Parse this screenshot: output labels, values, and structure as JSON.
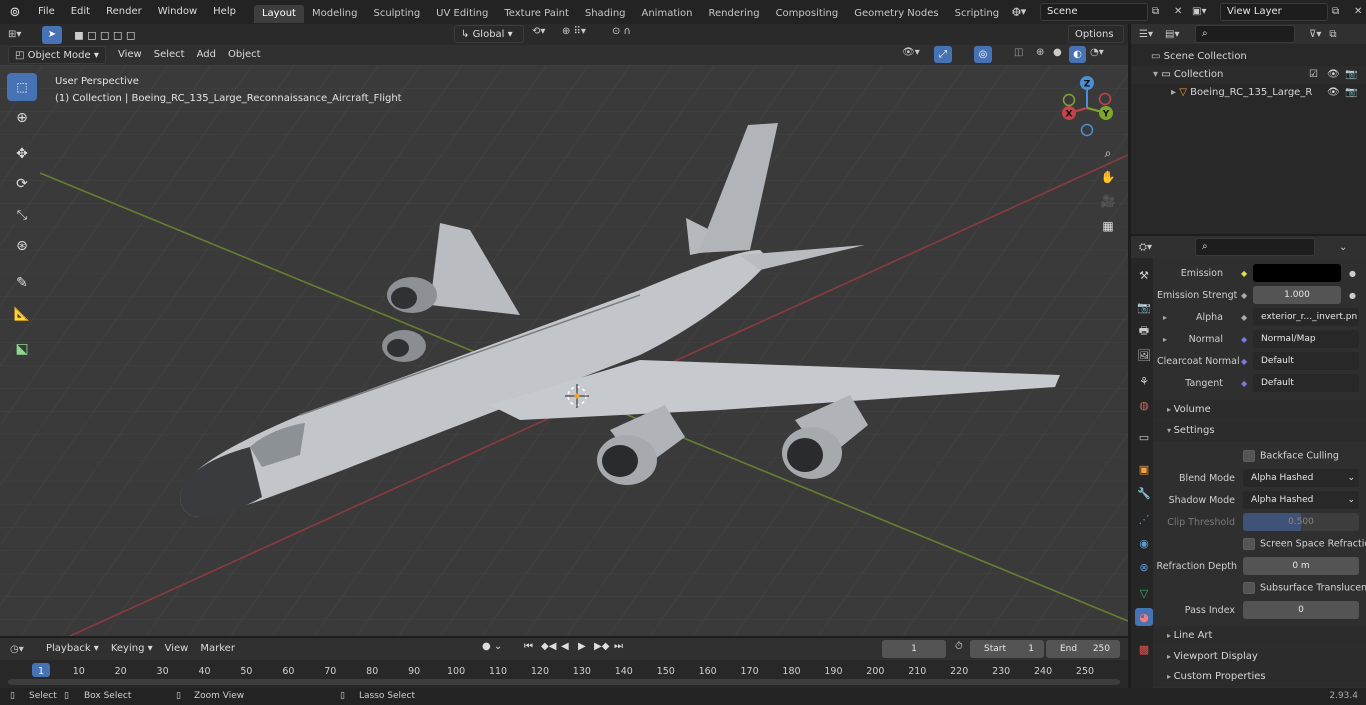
{
  "topbar": {
    "menus": [
      "File",
      "Edit",
      "Render",
      "Window",
      "Help"
    ],
    "workspaces": [
      "Layout",
      "Modeling",
      "Sculpting",
      "UV Editing",
      "Texture Paint",
      "Shading",
      "Animation",
      "Rendering",
      "Compositing",
      "Geometry Nodes",
      "Scripting"
    ],
    "active_workspace": "Layout",
    "scene": "Scene",
    "view_layer": "View Layer"
  },
  "viewport_header": {
    "mode": "Object Mode",
    "menus": [
      "View",
      "Select",
      "Add",
      "Object"
    ],
    "orientation": "Global",
    "options": "Options"
  },
  "viewport": {
    "perspective": "User Perspective",
    "collection_info": "(1) Collection | Boeing_RC_135_Large_Reconnaissance_Aircraft_Flight",
    "gizmo": {
      "z": "Z",
      "y": "Y",
      "x": "X"
    }
  },
  "outliner": {
    "scene_collection": "Scene Collection",
    "collection": "Collection",
    "object": "Boeing_RC_135_Large_R"
  },
  "properties": {
    "rows": [
      {
        "label": "Emission",
        "value": "",
        "type": "color"
      },
      {
        "label": "Emission Strengt",
        "value": "1.000",
        "type": "num"
      },
      {
        "label": "Alpha",
        "value": "exterior_r..._invert.pn",
        "type": "link"
      },
      {
        "label": "Normal",
        "value": "Normal/Map",
        "type": "link"
      },
      {
        "label": "Clearcoat Normal",
        "value": "Default",
        "type": "link"
      },
      {
        "label": "Tangent",
        "value": "Default",
        "type": "link"
      }
    ],
    "volume": "Volume",
    "settings": "Settings",
    "backface_culling": "Backface Culling",
    "blend_mode_label": "Blend Mode",
    "blend_mode": "Alpha Hashed",
    "shadow_mode_label": "Shadow Mode",
    "shadow_mode": "Alpha Hashed",
    "clip_threshold_label": "Clip Threshold",
    "clip_threshold": "0.500",
    "clip_threshold_fraction": 0.5,
    "ssr": "Screen Space Refraction",
    "refraction_depth_label": "Refraction Depth",
    "refraction_depth": "0 m",
    "subsurface": "Subsurface Translucency",
    "pass_index_label": "Pass Index",
    "pass_index": "0",
    "line_art": "Line Art",
    "viewport_display": "Viewport Display",
    "custom_properties": "Custom Properties"
  },
  "timeline": {
    "menus": [
      "Playback",
      "Keying",
      "View",
      "Marker"
    ],
    "current_frame": "1",
    "start_label": "Start",
    "start": "1",
    "end_label": "End",
    "end": "250",
    "ticks": [
      "1",
      "10",
      "20",
      "30",
      "40",
      "50",
      "60",
      "70",
      "80",
      "90",
      "100",
      "110",
      "120",
      "130",
      "140",
      "150",
      "160",
      "170",
      "180",
      "190",
      "200",
      "210",
      "220",
      "230",
      "240",
      "250"
    ]
  },
  "statusbar": {
    "select": "Select",
    "box_select": "Box Select",
    "zoom_view": "Zoom View",
    "lasso_select": "Lasso Select",
    "version": "2.93.4"
  },
  "colors": {
    "accent": "#4772b3",
    "x_axis": "#c3434b",
    "y_axis": "#7fa531",
    "z_axis": "#4d8fd6",
    "origin": "#f5a623"
  }
}
